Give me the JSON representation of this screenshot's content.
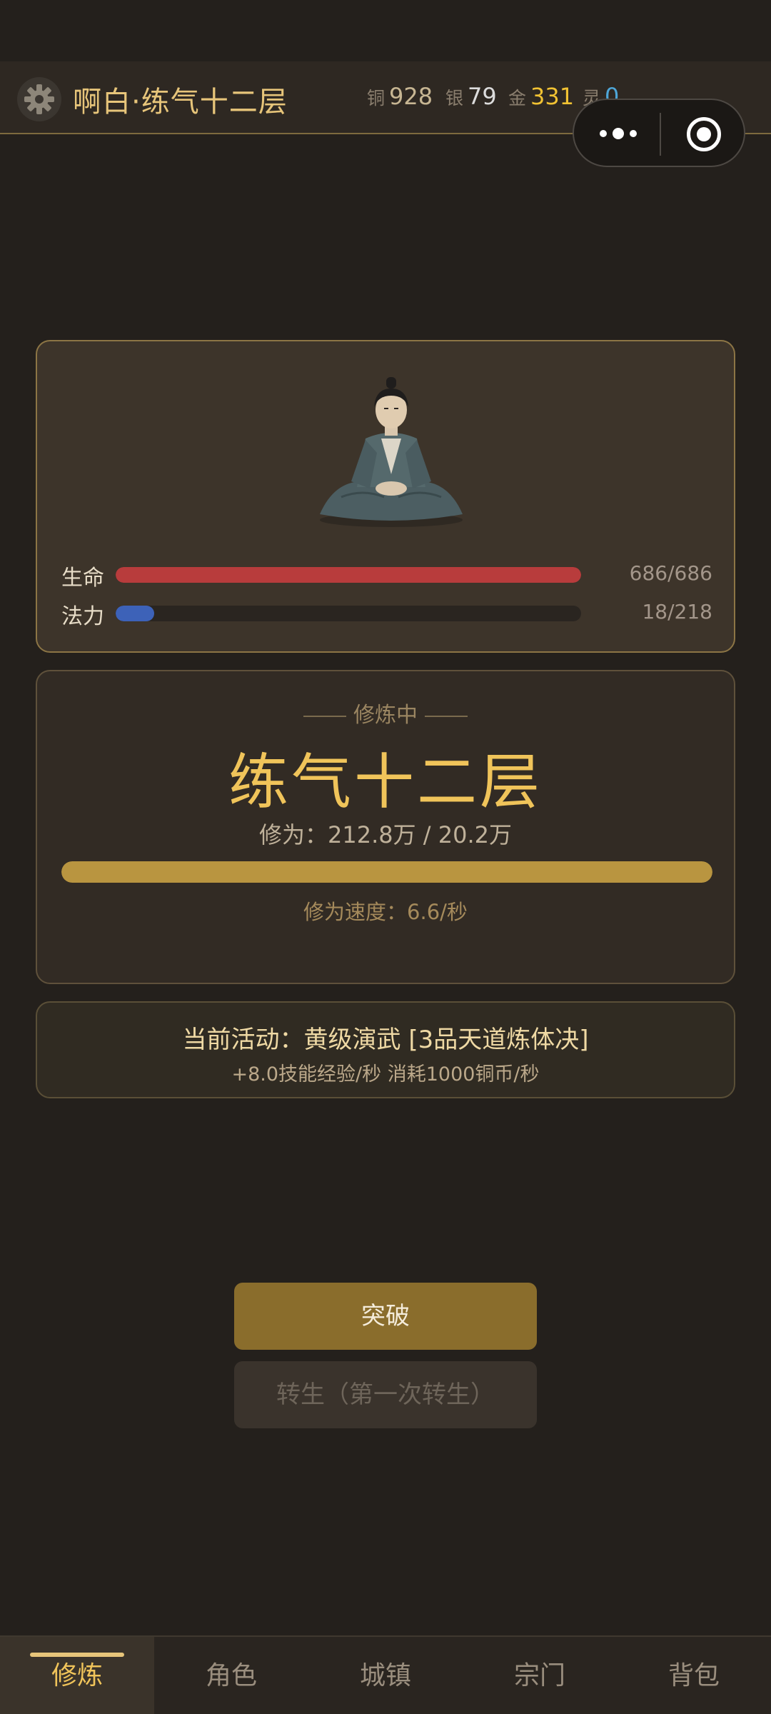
{
  "header": {
    "player_name": "啊白·练气十二层",
    "currencies": [
      {
        "label": "铜",
        "value": "928"
      },
      {
        "label": "银",
        "value": "79"
      },
      {
        "label": "金",
        "value": "331"
      },
      {
        "label": "灵",
        "value": "0"
      }
    ]
  },
  "status": {
    "hp": {
      "label": "生命",
      "value": "686/686",
      "fraction": 1.0,
      "color": "#b83c3c"
    },
    "mp": {
      "label": "法力",
      "value": "18/218",
      "fraction": 0.083,
      "color": "#3d62b8"
    }
  },
  "cultivation": {
    "status": "修炼中",
    "realm": "练气十二层",
    "xp_text": "修为：212.8万 / 20.2万",
    "xp_fraction": 1.0,
    "speed_text": "修为速度：6.6/秒"
  },
  "activity": {
    "title": "当前活动：黄级演武 [3品天道炼体决]",
    "detail": "+8.0技能经验/秒  消耗1000铜币/秒"
  },
  "buttons": {
    "breakthrough": "突破",
    "rebirth": "转生（第一次转生）"
  },
  "tabs": [
    {
      "label": "修炼",
      "active": true
    },
    {
      "label": "角色",
      "active": false
    },
    {
      "label": "城镇",
      "active": false
    },
    {
      "label": "宗门",
      "active": false
    },
    {
      "label": "背包",
      "active": false
    }
  ],
  "colors": {
    "accent": "#f0c45a",
    "gold_bar": "#b99540"
  }
}
